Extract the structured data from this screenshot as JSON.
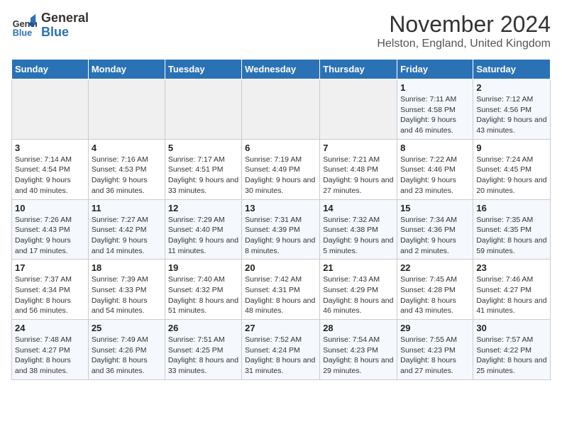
{
  "header": {
    "logo_line1": "General",
    "logo_line2": "Blue",
    "month": "November 2024",
    "location": "Helston, England, United Kingdom"
  },
  "days_of_week": [
    "Sunday",
    "Monday",
    "Tuesday",
    "Wednesday",
    "Thursday",
    "Friday",
    "Saturday"
  ],
  "weeks": [
    [
      {
        "day": "",
        "info": ""
      },
      {
        "day": "",
        "info": ""
      },
      {
        "day": "",
        "info": ""
      },
      {
        "day": "",
        "info": ""
      },
      {
        "day": "",
        "info": ""
      },
      {
        "day": "1",
        "info": "Sunrise: 7:11 AM\nSunset: 4:58 PM\nDaylight: 9 hours and 46 minutes."
      },
      {
        "day": "2",
        "info": "Sunrise: 7:12 AM\nSunset: 4:56 PM\nDaylight: 9 hours and 43 minutes."
      }
    ],
    [
      {
        "day": "3",
        "info": "Sunrise: 7:14 AM\nSunset: 4:54 PM\nDaylight: 9 hours and 40 minutes."
      },
      {
        "day": "4",
        "info": "Sunrise: 7:16 AM\nSunset: 4:53 PM\nDaylight: 9 hours and 36 minutes."
      },
      {
        "day": "5",
        "info": "Sunrise: 7:17 AM\nSunset: 4:51 PM\nDaylight: 9 hours and 33 minutes."
      },
      {
        "day": "6",
        "info": "Sunrise: 7:19 AM\nSunset: 4:49 PM\nDaylight: 9 hours and 30 minutes."
      },
      {
        "day": "7",
        "info": "Sunrise: 7:21 AM\nSunset: 4:48 PM\nDaylight: 9 hours and 27 minutes."
      },
      {
        "day": "8",
        "info": "Sunrise: 7:22 AM\nSunset: 4:46 PM\nDaylight: 9 hours and 23 minutes."
      },
      {
        "day": "9",
        "info": "Sunrise: 7:24 AM\nSunset: 4:45 PM\nDaylight: 9 hours and 20 minutes."
      }
    ],
    [
      {
        "day": "10",
        "info": "Sunrise: 7:26 AM\nSunset: 4:43 PM\nDaylight: 9 hours and 17 minutes."
      },
      {
        "day": "11",
        "info": "Sunrise: 7:27 AM\nSunset: 4:42 PM\nDaylight: 9 hours and 14 minutes."
      },
      {
        "day": "12",
        "info": "Sunrise: 7:29 AM\nSunset: 4:40 PM\nDaylight: 9 hours and 11 minutes."
      },
      {
        "day": "13",
        "info": "Sunrise: 7:31 AM\nSunset: 4:39 PM\nDaylight: 9 hours and 8 minutes."
      },
      {
        "day": "14",
        "info": "Sunrise: 7:32 AM\nSunset: 4:38 PM\nDaylight: 9 hours and 5 minutes."
      },
      {
        "day": "15",
        "info": "Sunrise: 7:34 AM\nSunset: 4:36 PM\nDaylight: 9 hours and 2 minutes."
      },
      {
        "day": "16",
        "info": "Sunrise: 7:35 AM\nSunset: 4:35 PM\nDaylight: 8 hours and 59 minutes."
      }
    ],
    [
      {
        "day": "17",
        "info": "Sunrise: 7:37 AM\nSunset: 4:34 PM\nDaylight: 8 hours and 56 minutes."
      },
      {
        "day": "18",
        "info": "Sunrise: 7:39 AM\nSunset: 4:33 PM\nDaylight: 8 hours and 54 minutes."
      },
      {
        "day": "19",
        "info": "Sunrise: 7:40 AM\nSunset: 4:32 PM\nDaylight: 8 hours and 51 minutes."
      },
      {
        "day": "20",
        "info": "Sunrise: 7:42 AM\nSunset: 4:31 PM\nDaylight: 8 hours and 48 minutes."
      },
      {
        "day": "21",
        "info": "Sunrise: 7:43 AM\nSunset: 4:29 PM\nDaylight: 8 hours and 46 minutes."
      },
      {
        "day": "22",
        "info": "Sunrise: 7:45 AM\nSunset: 4:28 PM\nDaylight: 8 hours and 43 minutes."
      },
      {
        "day": "23",
        "info": "Sunrise: 7:46 AM\nSunset: 4:27 PM\nDaylight: 8 hours and 41 minutes."
      }
    ],
    [
      {
        "day": "24",
        "info": "Sunrise: 7:48 AM\nSunset: 4:27 PM\nDaylight: 8 hours and 38 minutes."
      },
      {
        "day": "25",
        "info": "Sunrise: 7:49 AM\nSunset: 4:26 PM\nDaylight: 8 hours and 36 minutes."
      },
      {
        "day": "26",
        "info": "Sunrise: 7:51 AM\nSunset: 4:25 PM\nDaylight: 8 hours and 33 minutes."
      },
      {
        "day": "27",
        "info": "Sunrise: 7:52 AM\nSunset: 4:24 PM\nDaylight: 8 hours and 31 minutes."
      },
      {
        "day": "28",
        "info": "Sunrise: 7:54 AM\nSunset: 4:23 PM\nDaylight: 8 hours and 29 minutes."
      },
      {
        "day": "29",
        "info": "Sunrise: 7:55 AM\nSunset: 4:23 PM\nDaylight: 8 hours and 27 minutes."
      },
      {
        "day": "30",
        "info": "Sunrise: 7:57 AM\nSunset: 4:22 PM\nDaylight: 8 hours and 25 minutes."
      }
    ]
  ]
}
